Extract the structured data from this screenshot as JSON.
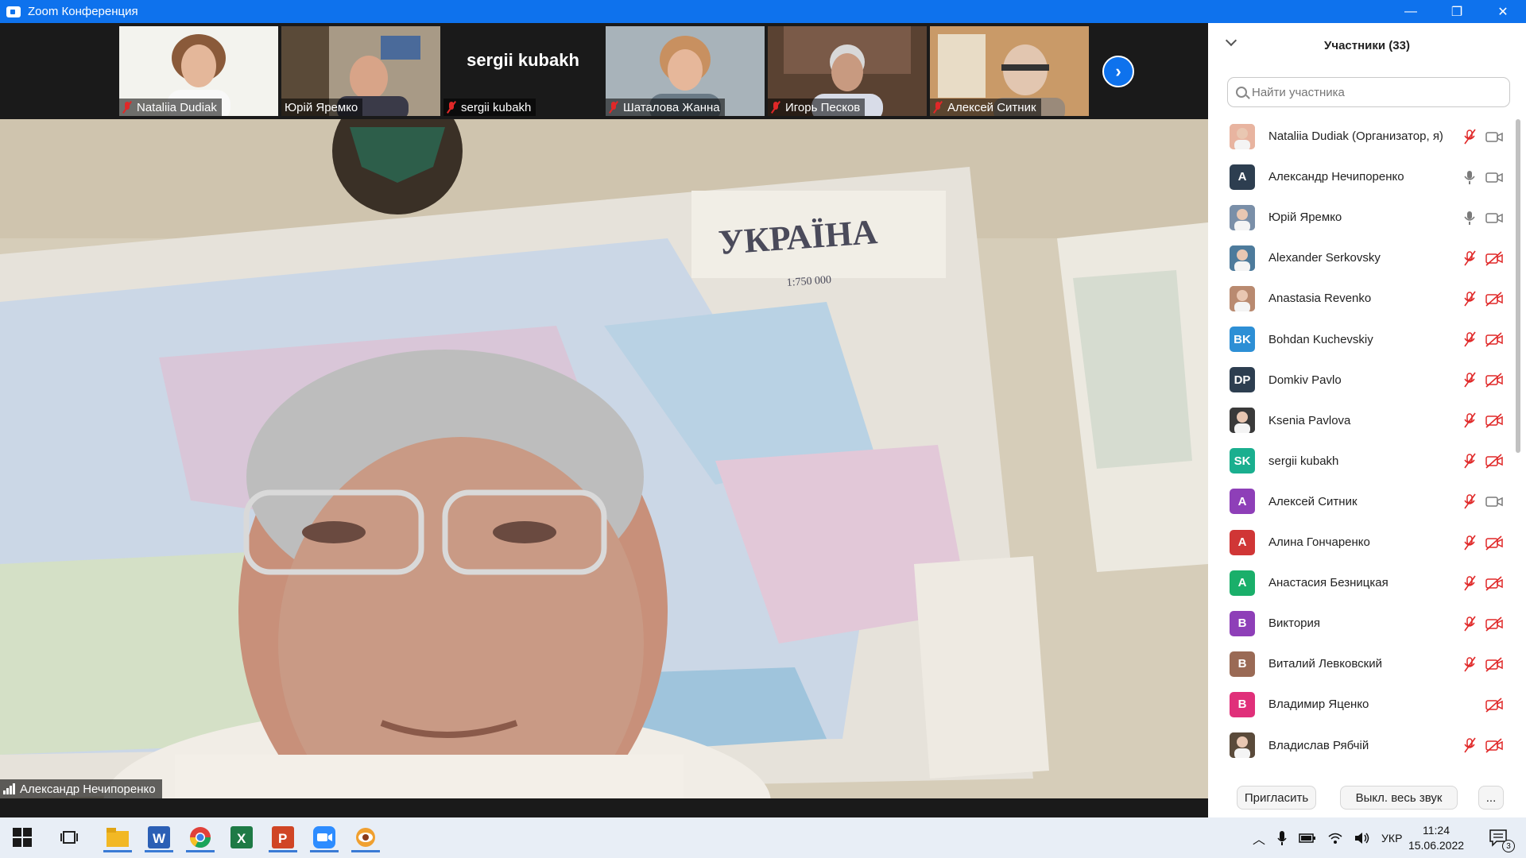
{
  "window": {
    "title": "Zoom Конференция",
    "minimize": "—",
    "maximize": "❐",
    "close": "✕"
  },
  "thumbnails": [
    {
      "name": "Nataliia Dudiak",
      "type": "video"
    },
    {
      "name": "Юрій Яремко",
      "type": "video"
    },
    {
      "name": "sergii kubakh",
      "type": "text",
      "display": "sergii kubakh"
    },
    {
      "name": "Шаталова Жанна",
      "type": "video"
    },
    {
      "name": "Игорь Песков",
      "type": "video"
    },
    {
      "name": "Алексей Ситник",
      "type": "video"
    }
  ],
  "next_page": "›",
  "main_video": {
    "speaker": "Александр Нечипоренко",
    "map_title": "УКРАЇНА",
    "map_scale": "1:750 000"
  },
  "panel": {
    "title": "Участники (33)",
    "search_placeholder": "Найти участника",
    "participants": [
      {
        "name": "Nataliia Dudiak (Организатор, я)",
        "initials": "",
        "color": "#e8b4a0",
        "mic": "muted",
        "cam": "on"
      },
      {
        "name": "Александр Нечипоренко",
        "initials": "A",
        "color": "#2d3e50",
        "mic": "on",
        "cam": "on"
      },
      {
        "name": "Юрій Яремко",
        "initials": "",
        "color": "#7a8fa8",
        "mic": "on",
        "cam": "on"
      },
      {
        "name": "Alexander Serkovsky",
        "initials": "",
        "color": "#4d7b9c",
        "mic": "muted",
        "cam": "off"
      },
      {
        "name": "Anastasia Revenko",
        "initials": "",
        "color": "#b98a70",
        "mic": "muted",
        "cam": "off"
      },
      {
        "name": "Bohdan Kuchevskiy",
        "initials": "BK",
        "color": "#2d8fd5",
        "mic": "muted",
        "cam": "off"
      },
      {
        "name": "Domkiv Pavlo",
        "initials": "DP",
        "color": "#2d3e50",
        "mic": "muted",
        "cam": "off"
      },
      {
        "name": "Ksenia Pavlova",
        "initials": "",
        "color": "#3a3a3a",
        "mic": "muted",
        "cam": "off"
      },
      {
        "name": "sergii kubakh",
        "initials": "SK",
        "color": "#1aaf8f",
        "mic": "muted",
        "cam": "off"
      },
      {
        "name": "Алексей Ситник",
        "initials": "A",
        "color": "#8e3fb8",
        "mic": "muted",
        "cam": "on"
      },
      {
        "name": "Алина Гончаренко",
        "initials": "A",
        "color": "#d03636",
        "mic": "muted",
        "cam": "off"
      },
      {
        "name": "Анастасия Безницкая",
        "initials": "A",
        "color": "#1aaf6a",
        "mic": "muted",
        "cam": "off"
      },
      {
        "name": "Виктория",
        "initials": "B",
        "color": "#8e3fb8",
        "mic": "muted",
        "cam": "off"
      },
      {
        "name": "Виталий Левковский",
        "initials": "B",
        "color": "#9a6a55",
        "mic": "muted",
        "cam": "off"
      },
      {
        "name": "Владимир Яценко",
        "initials": "B",
        "color": "#e0307a",
        "mic": "none",
        "cam": "off"
      },
      {
        "name": "Владислав Рябчій",
        "initials": "",
        "color": "#5a4a3a",
        "mic": "muted",
        "cam": "off"
      }
    ],
    "invite_label": "Пригласить",
    "mute_all_label": "Выкл. весь звук",
    "more_label": "..."
  },
  "taskbar": {
    "apps": [
      "windows-start",
      "task-view",
      "file-explorer",
      "word",
      "chrome",
      "excel",
      "powerpoint",
      "zoom",
      "app"
    ],
    "language": "УКР",
    "time": "11:24",
    "date": "15.06.2022",
    "notifications": "3"
  },
  "colors": {
    "accent": "#0e72ed",
    "muted_red": "#e02828"
  }
}
